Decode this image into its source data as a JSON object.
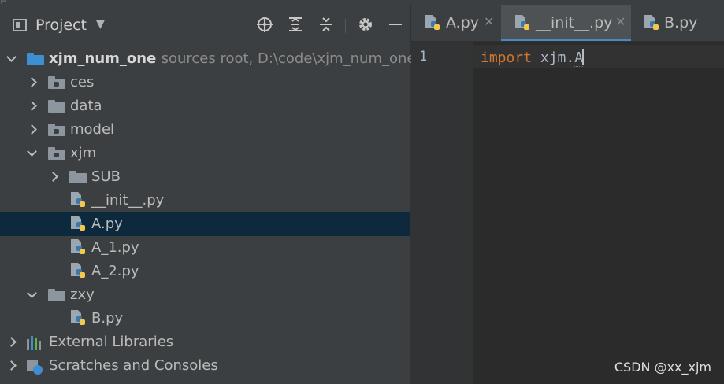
{
  "window": {
    "partial_title": "p"
  },
  "project_panel": {
    "title": "Project",
    "toolbar_icons": [
      "locate-icon",
      "expand-all-icon",
      "collapse-all-icon",
      "gear-icon",
      "minimize-icon"
    ]
  },
  "tree": [
    {
      "label": "xjm_num_one",
      "hint": "sources root,  D:\\code\\xjm_num_one",
      "kind": "module-folder",
      "expanded": true
    },
    {
      "label": "ces",
      "kind": "package-folder",
      "expanded": false
    },
    {
      "label": "data",
      "kind": "folder",
      "expanded": false
    },
    {
      "label": "model",
      "kind": "package-folder",
      "expanded": false
    },
    {
      "label": "xjm",
      "kind": "package-folder",
      "expanded": true
    },
    {
      "label": "SUB",
      "kind": "folder",
      "expanded": false
    },
    {
      "label": "__init__.py",
      "kind": "python-file"
    },
    {
      "label": "A.py",
      "kind": "python-file",
      "selected": true
    },
    {
      "label": "A_1.py",
      "kind": "python-file"
    },
    {
      "label": "A_2.py",
      "kind": "python-file"
    },
    {
      "label": "zxy",
      "kind": "folder",
      "expanded": true
    },
    {
      "label": "B.py",
      "kind": "python-file"
    },
    {
      "label": "External Libraries",
      "kind": "libraries",
      "expanded": false
    },
    {
      "label": "Scratches and Consoles",
      "kind": "scratches",
      "expanded": false
    }
  ],
  "editor": {
    "tabs": [
      {
        "label": "A.py",
        "active": false
      },
      {
        "label": "__init__.py",
        "active": true
      },
      {
        "label": "B.py",
        "active": false
      }
    ],
    "line_number": "1",
    "code": {
      "keyword": "import",
      "rest": " xjm.",
      "last": "A"
    }
  },
  "watermark": "CSDN @xx_xjm",
  "colors": {
    "selection": "#0d293e",
    "keyword": "#cc7832",
    "active_tab_underline": "#4a88c7",
    "module_folder": "#3d8fd1"
  }
}
